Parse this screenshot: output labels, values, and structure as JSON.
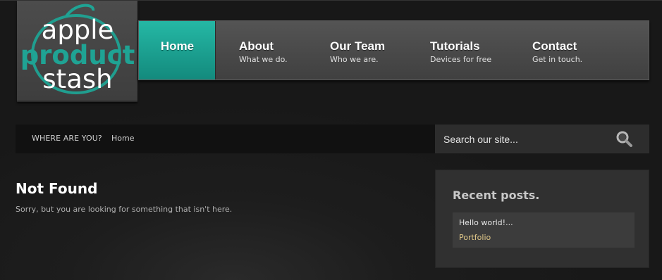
{
  "logo": {
    "line1": "apple",
    "line2": "product",
    "line3": "stash"
  },
  "nav": {
    "items": [
      {
        "title": "Home",
        "sub": ""
      },
      {
        "title": "About",
        "sub": "What we do."
      },
      {
        "title": "Our Team",
        "sub": "Who we are."
      },
      {
        "title": "Tutorials",
        "sub": "Devices for free"
      },
      {
        "title": "Contact",
        "sub": "Get in touch."
      }
    ]
  },
  "breadcrumb": {
    "label": "WHERE ARE YOU?",
    "home": "Home"
  },
  "search": {
    "placeholder": "Search our site..."
  },
  "main": {
    "title": "Not Found",
    "text": "Sorry, but you are looking for something that isn't here."
  },
  "sidebar": {
    "widget_title": "Recent posts.",
    "posts": [
      "Hello world!...",
      "Portfolio"
    ]
  },
  "colors": {
    "accent": "#1fa394",
    "background": "#1c1c1c",
    "link": "#e2c98a"
  },
  "icons": [
    "search-icon"
  ]
}
